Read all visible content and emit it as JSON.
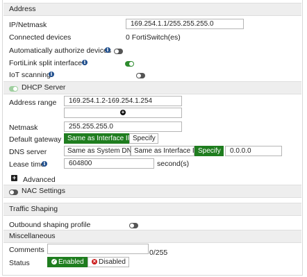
{
  "address": {
    "section_title": "Address",
    "ip_label": "IP/Netmask",
    "ip_value": "169.254.1.1/255.255.255.0",
    "connected_label": "Connected devices",
    "connected_value": "0 FortiSwitch(es)",
    "auto_auth_label": "Automatically authorize devices",
    "fortilink_split_label": "FortiLink split interface",
    "iot_label": "IoT scanning"
  },
  "dhcp": {
    "title": "DHCP Server",
    "range_label": "Address range",
    "range_value": "169.254.1.2-169.254.1.254",
    "netmask_label": "Netmask",
    "netmask_value": "255.255.255.0",
    "gateway_label": "Default gateway",
    "gateway_options": [
      "Same as Interface IP",
      "Specify"
    ],
    "dns_label": "DNS server",
    "dns_options": [
      "Same as System DNS",
      "Same as Interface IP",
      "Specify"
    ],
    "dns_value": "0.0.0.0",
    "lease_label": "Lease time",
    "lease_value": "604800",
    "lease_unit": "second(s)",
    "advanced_label": "Advanced"
  },
  "nac": {
    "title": "NAC Settings"
  },
  "traffic": {
    "title": "Traffic Shaping",
    "outbound_label": "Outbound shaping profile"
  },
  "misc": {
    "title": "Miscellaneous",
    "comments_label": "Comments",
    "comments_count": "0/255",
    "status_label": "Status",
    "enabled_label": "Enabled",
    "disabled_label": "Disabled"
  },
  "icons": {
    "info": "info-icon",
    "add": "plus-icon",
    "toggle": "toggle-switch",
    "enabled": "check-circle-icon",
    "disabled": "x-circle-icon"
  },
  "colors": {
    "accent_green": "#1f7d1f",
    "info_blue": "#1f4e8c",
    "disabled_red": "#cc1f1f"
  }
}
